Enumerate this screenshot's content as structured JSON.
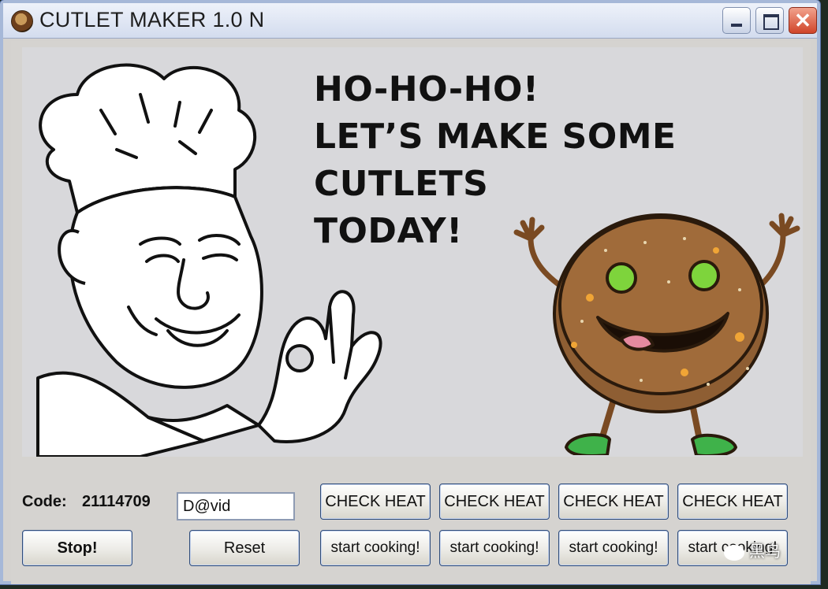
{
  "window": {
    "title": "CUTLET MAKER 1.0 N",
    "minimize": "–",
    "maximize": "□",
    "close": "✕"
  },
  "banner": {
    "lines": [
      "HO-HO-HO!",
      "LET’S MAKE SOME",
      "CUTLETS",
      "TODAY!"
    ],
    "chef_image": "chef-ok-gesture",
    "cutlet_image": "smiling-cutlet-character"
  },
  "code": {
    "label": "Code:",
    "value": "21114709"
  },
  "name_input": {
    "value": "D@vid"
  },
  "buttons": {
    "stop": "Stop!",
    "reset": "Reset",
    "check_heat": [
      "CHECK HEAT",
      "CHECK HEAT",
      "CHECK HEAT",
      "CHECK HEAT"
    ],
    "start_cooking": [
      "start cooking!",
      "start cooking!",
      "start cooking!",
      "start cooking!"
    ]
  },
  "watermark": "黑鸟",
  "colors": {
    "window_bg": "#d5d3d0",
    "art_bg": "#d8d8db",
    "cutlet": "#a06b3a",
    "peas": "#7ed43c",
    "shoes": "#3fb24a"
  }
}
